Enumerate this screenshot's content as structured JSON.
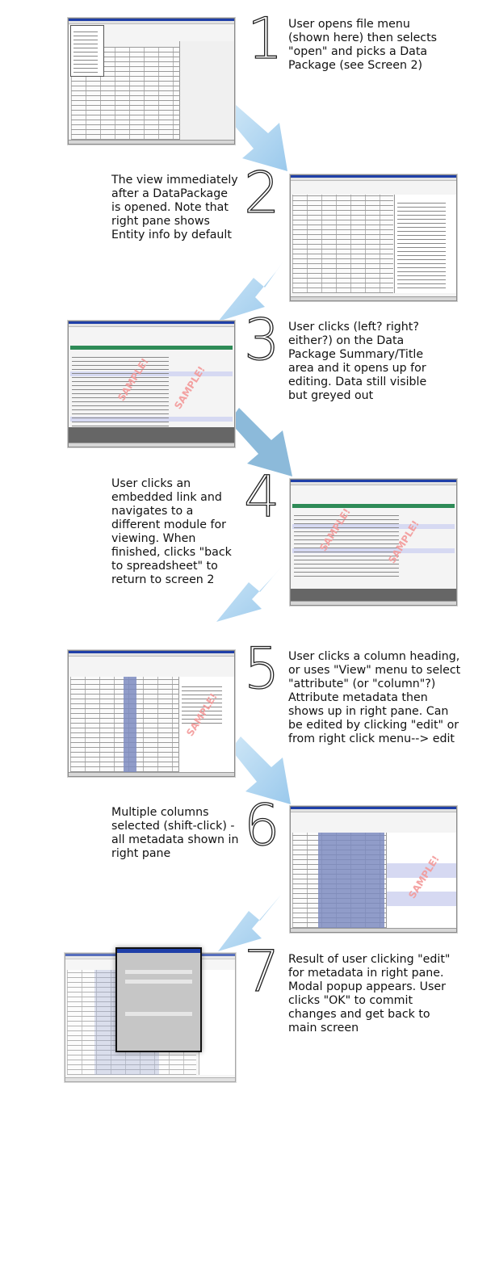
{
  "steps": [
    {
      "number": "1",
      "text": "User opens file menu\n(shown here) then selects\n\"open\" and picks a Data\nPackage (see Screen 2)"
    },
    {
      "number": "2",
      "text": "The view immediately\nafter a DataPackage\nis opened.  Note that\nright pane shows\nEntity info by default"
    },
    {
      "number": "3",
      "text": "User clicks (left? right?\neither?) on the Data\nPackage Summary/Title\narea and it opens up for\nediting.  Data still visible\nbut greyed out"
    },
    {
      "number": "4",
      "text": "User clicks an\nembedded link and\nnavigates to a\ndifferent module for\nviewing.  When\nfinished, clicks \"back\nto spreadsheet\" to\nreturn to screen 2"
    },
    {
      "number": "5",
      "text": "User clicks a column heading,\nor uses \"View\" menu to select\n\"attribute\" (or \"column\"?)\nAttribute metadata then\nshows up in right pane.  Can\nbe edited by clicking \"edit\" or\nfrom right click menu--> edit"
    },
    {
      "number": "6",
      "text": "Multiple columns\nselected (shift-click) -\nall metadata shown in\nright pane"
    },
    {
      "number": "7",
      "text": "Result of user clicking \"edit\"\nfor metadata in right pane.\nModal popup appears.  User\nclicks \"OK\" to commit\nchanges and get back to\nmain screen"
    }
  ],
  "watermark": "SAMPLE!",
  "colors": {
    "arrow": "#a9d3ef",
    "selection": "#7c8bbf",
    "titlebar": "#1f3fa8",
    "watermark": "#f39a9a"
  }
}
